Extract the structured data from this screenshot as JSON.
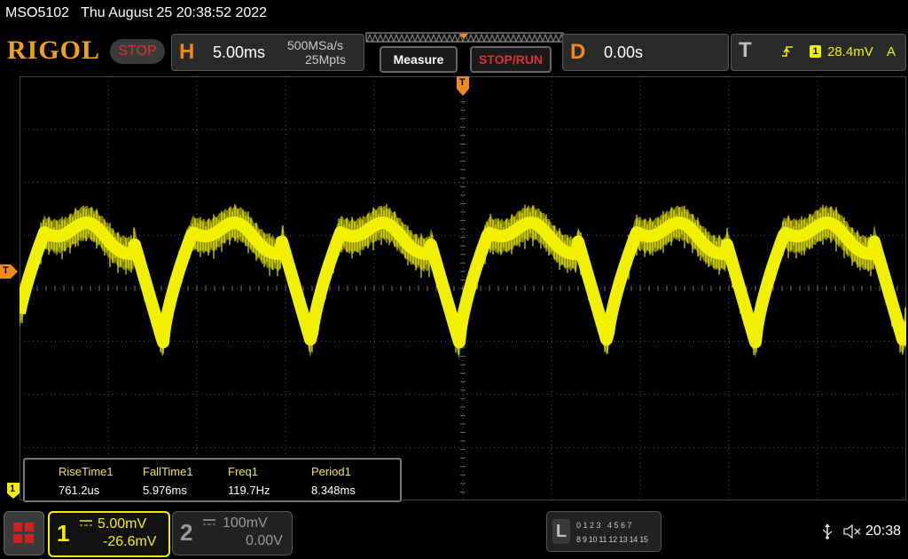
{
  "titlebar": {
    "model": "MSO5102",
    "datetime": "Thu August 25 20:38:52 2022"
  },
  "brand": {
    "logo": "RIGOL",
    "run_state": "STOP"
  },
  "horizontal": {
    "letter": "H",
    "timebase": "5.00ms",
    "sample_rate": "500MSa/s",
    "memory_depth": "25Mpts"
  },
  "buttons": {
    "measure": "Measure",
    "stop_run": "STOP/RUN"
  },
  "delay": {
    "letter": "D",
    "value": "0.00s"
  },
  "trigger": {
    "letter": "T",
    "source": "1",
    "level": "28.4mV",
    "mode": "A"
  },
  "markers": {
    "trigger_top": "T",
    "trigger_left": "T",
    "channel1_ground": "1"
  },
  "measurements": [
    {
      "label": "RiseTime1",
      "value": "761.2us"
    },
    {
      "label": "FallTime1",
      "value": "5.976ms"
    },
    {
      "label": "Freq1",
      "value": "119.7Hz"
    },
    {
      "label": "Period1",
      "value": "8.348ms"
    }
  ],
  "channel1": {
    "number": "1",
    "scale": "5.00mV",
    "offset": "-26.6mV"
  },
  "channel2": {
    "number": "2",
    "scale": "100mV",
    "offset": "0.00V"
  },
  "logic": {
    "letter": "L",
    "row1": "0 1 2 3   4 5 6 7",
    "row2": "8 9 10 11 12 13 14 15"
  },
  "status": {
    "time": "20:38"
  },
  "colors": {
    "ch1": "#f0f000",
    "accent": "#f08a20",
    "stop": "#e03030",
    "grid": "#5a5a5a"
  },
  "waveform": {
    "period_divisions": 1.67,
    "cycles_visible": 6
  }
}
